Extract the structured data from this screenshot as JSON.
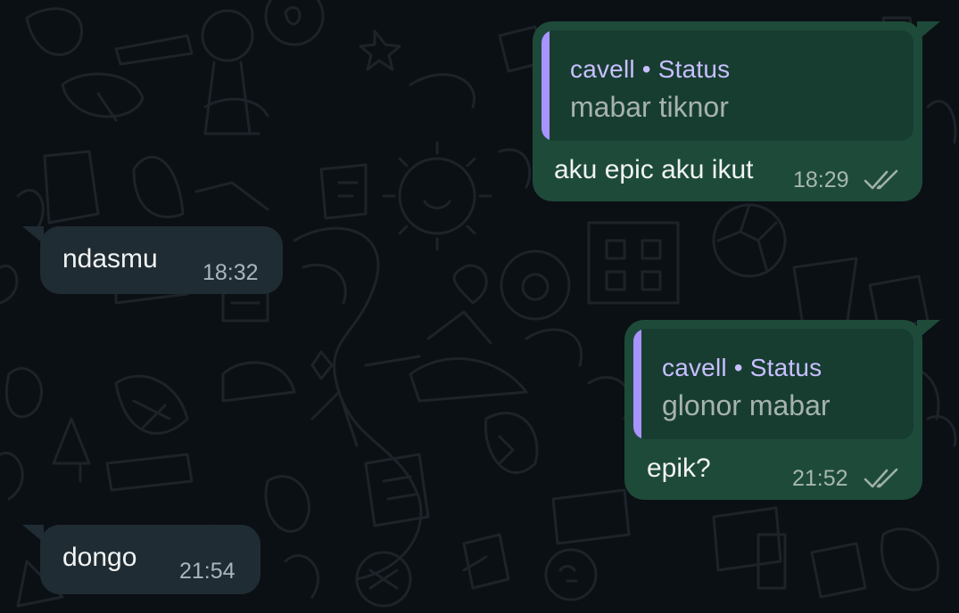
{
  "messages": [
    {
      "direction": "outgoing",
      "reply": {
        "author": "cavell • Status",
        "text": "mabar tiknor"
      },
      "text": "aku epic aku ikut",
      "time": "18:29",
      "status_icon": "double-check-icon"
    },
    {
      "direction": "incoming",
      "text": "ndasmu",
      "time": "18:32"
    },
    {
      "direction": "outgoing",
      "reply": {
        "author": "cavell • Status",
        "text": "glonor mabar"
      },
      "text": "epik?",
      "time": "21:52",
      "status_icon": "double-check-icon"
    },
    {
      "direction": "incoming",
      "text": "dongo",
      "time": "21:54"
    }
  ],
  "colors": {
    "background": "#0b1014",
    "incoming_bubble": "#202c33",
    "outgoing_bubble": "#1e4a3a",
    "quote_accent": "#a794ff"
  }
}
